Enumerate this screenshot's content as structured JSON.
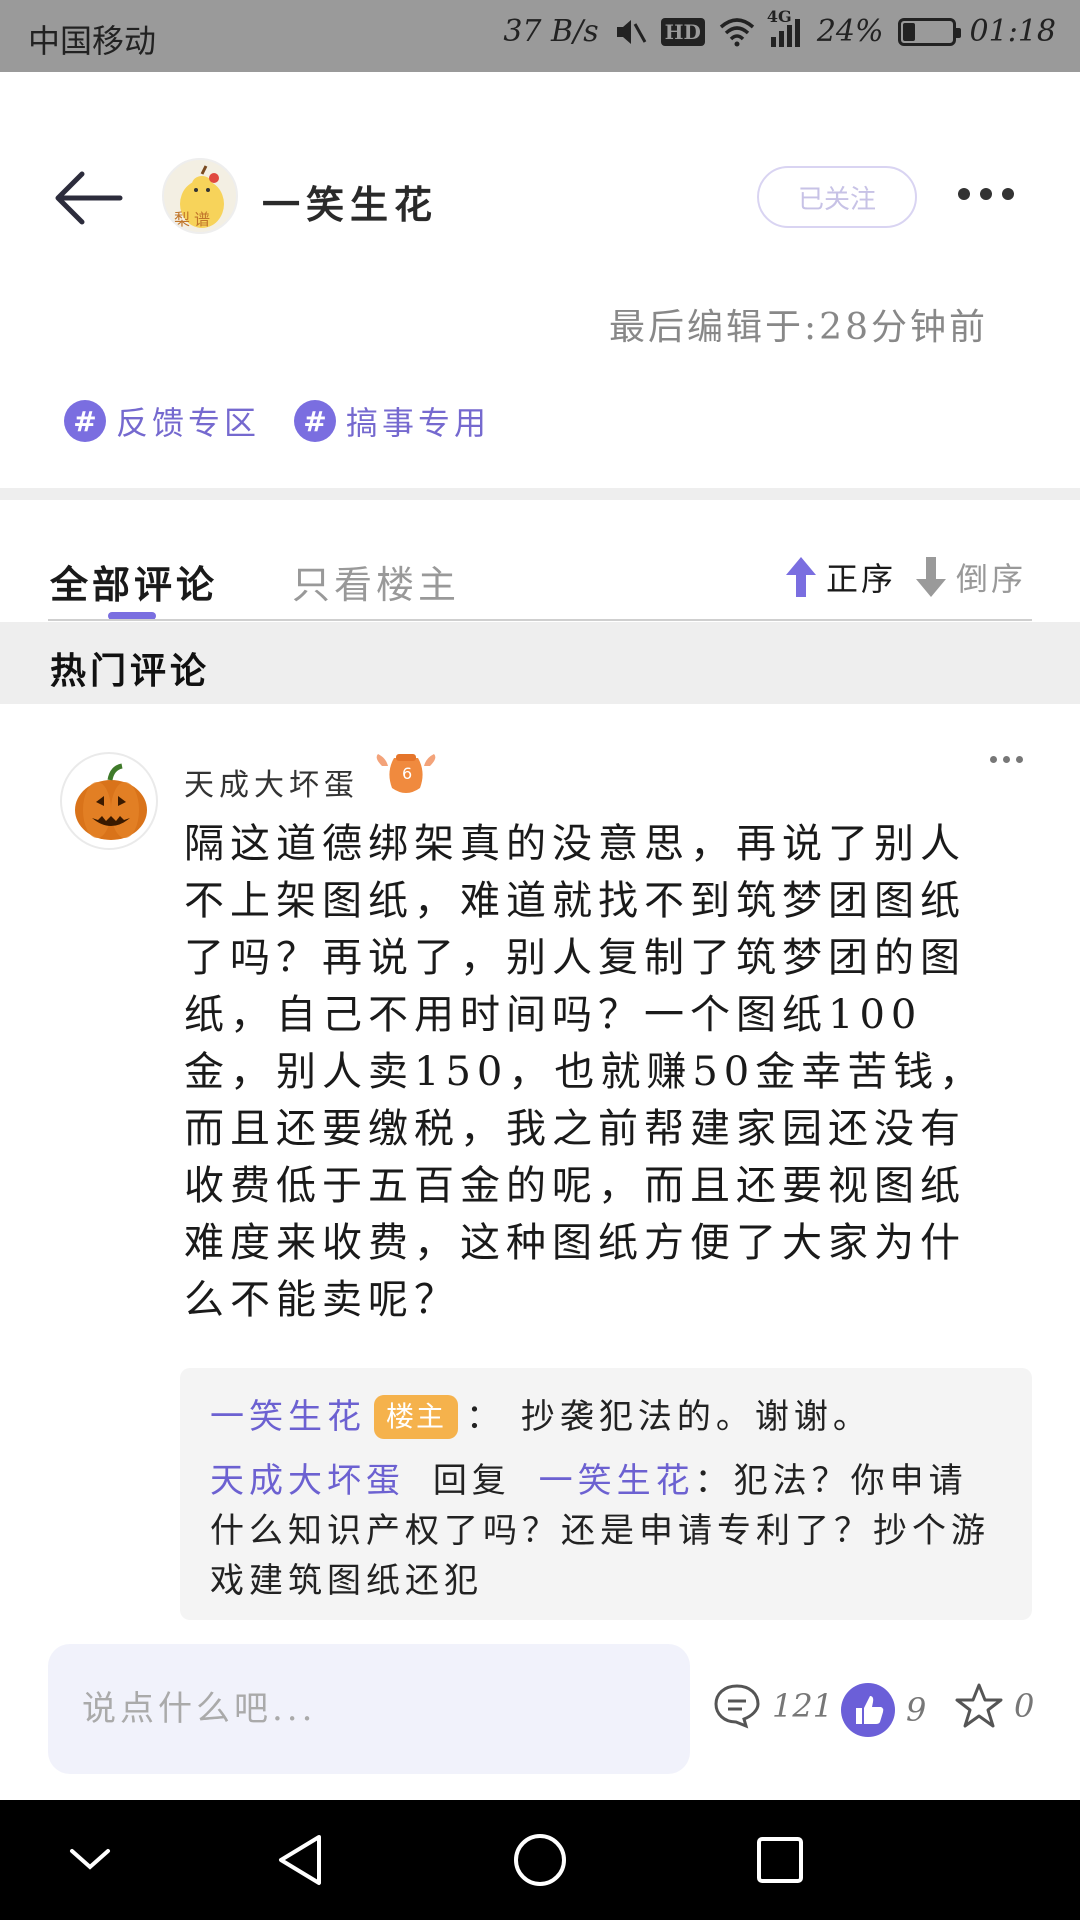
{
  "status_bar": {
    "carrier": "中国移动",
    "net_speed": "37 B/s",
    "hd_label": "HD",
    "network": "4G",
    "battery": "24%",
    "battery_level": 0.24,
    "time": "01:18",
    "icons": [
      "mute-icon",
      "hd-icon",
      "wifi-icon",
      "signal-icon",
      "battery-icon"
    ]
  },
  "header": {
    "author_name": "一笑生花",
    "avatar_text": "梨谱",
    "follow_label": "已关注",
    "edited_text": "最后编辑于:28分钟前"
  },
  "tags": [
    {
      "hash": "#",
      "label": "反馈专区"
    },
    {
      "hash": "#",
      "label": "搞事专用"
    }
  ],
  "tabs": {
    "all_comments": "全部评论",
    "author_only": "只看楼主",
    "sort_asc": "正序",
    "sort_desc": "倒序"
  },
  "section_title": "热门评论",
  "comment": {
    "author": "天成大坏蛋",
    "level": "6",
    "body": "隔这道德绑架真的没意思，再说了别人不上架图纸，难道就找不到筑梦团图纸了吗？再说了，别人复制了筑梦团的图纸，自己不用时间吗？一个图纸100金，别人卖150，也就赚50金幸苦钱，而且还要缴税，我之前帮建家园还没有收费低于五百金的呢，而且还要视图纸难度来收费，这种图纸方便了大家为什么不能卖呢？",
    "replies": [
      {
        "from": "一笑生花",
        "badge": "楼主",
        "sep": "：",
        "text": "抄袭犯法的。谢谢。"
      },
      {
        "from": "天成大坏蛋",
        "reply_word": "回复",
        "to": "一笑生花",
        "sep": "：",
        "text": "犯法？你申请什么知识产权了吗？还是申请专利了？抄个游戏建筑图纸还犯"
      }
    ]
  },
  "bottom_bar": {
    "input_placeholder": "说点什么吧...",
    "comment_count": "121",
    "like_count": "9",
    "star_count": "0"
  },
  "colors": {
    "accent": "#7a6ee0",
    "owner_badge": "#f5b24c",
    "status_bar_bg": "#9a9a9a"
  }
}
